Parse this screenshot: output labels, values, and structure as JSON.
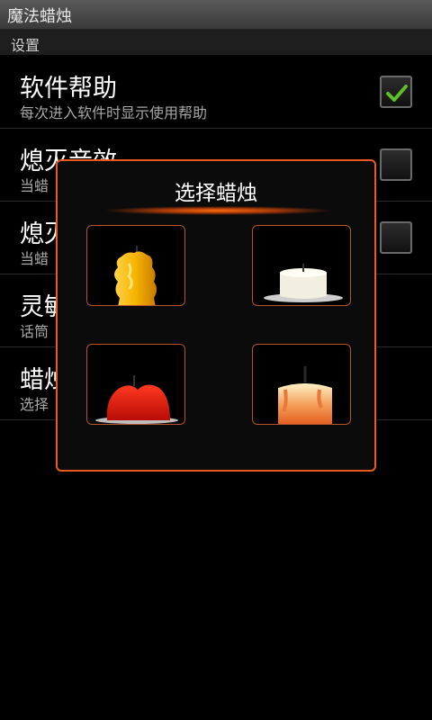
{
  "app": {
    "title": "魔法蜡烛"
  },
  "section": {
    "label": "设置"
  },
  "settings": [
    {
      "title": "软件帮助",
      "subtitle": "每次进入软件时显示使用帮助",
      "checked": true
    },
    {
      "title": "熄灭音效",
      "subtitle": "当蜡",
      "checked": false
    },
    {
      "title": "熄灭",
      "subtitle": "当蜡",
      "checked": false
    },
    {
      "title": "灵敏",
      "subtitle": "话筒"
    },
    {
      "title": "蜡烛",
      "subtitle": "选择"
    }
  ],
  "dialog": {
    "title": "选择蜡烛",
    "candles": [
      {
        "name": "candle-yellow-wax-icon",
        "color": "#f2a000"
      },
      {
        "name": "candle-white-pillar-icon",
        "color": "#f3efe0"
      },
      {
        "name": "candle-red-heart-icon",
        "color": "#e0200e"
      },
      {
        "name": "candle-melting-orange-icon",
        "color": "#f08a3a"
      }
    ]
  },
  "colors": {
    "accent": "#ea5a1c",
    "check": "#5fbf2a"
  }
}
